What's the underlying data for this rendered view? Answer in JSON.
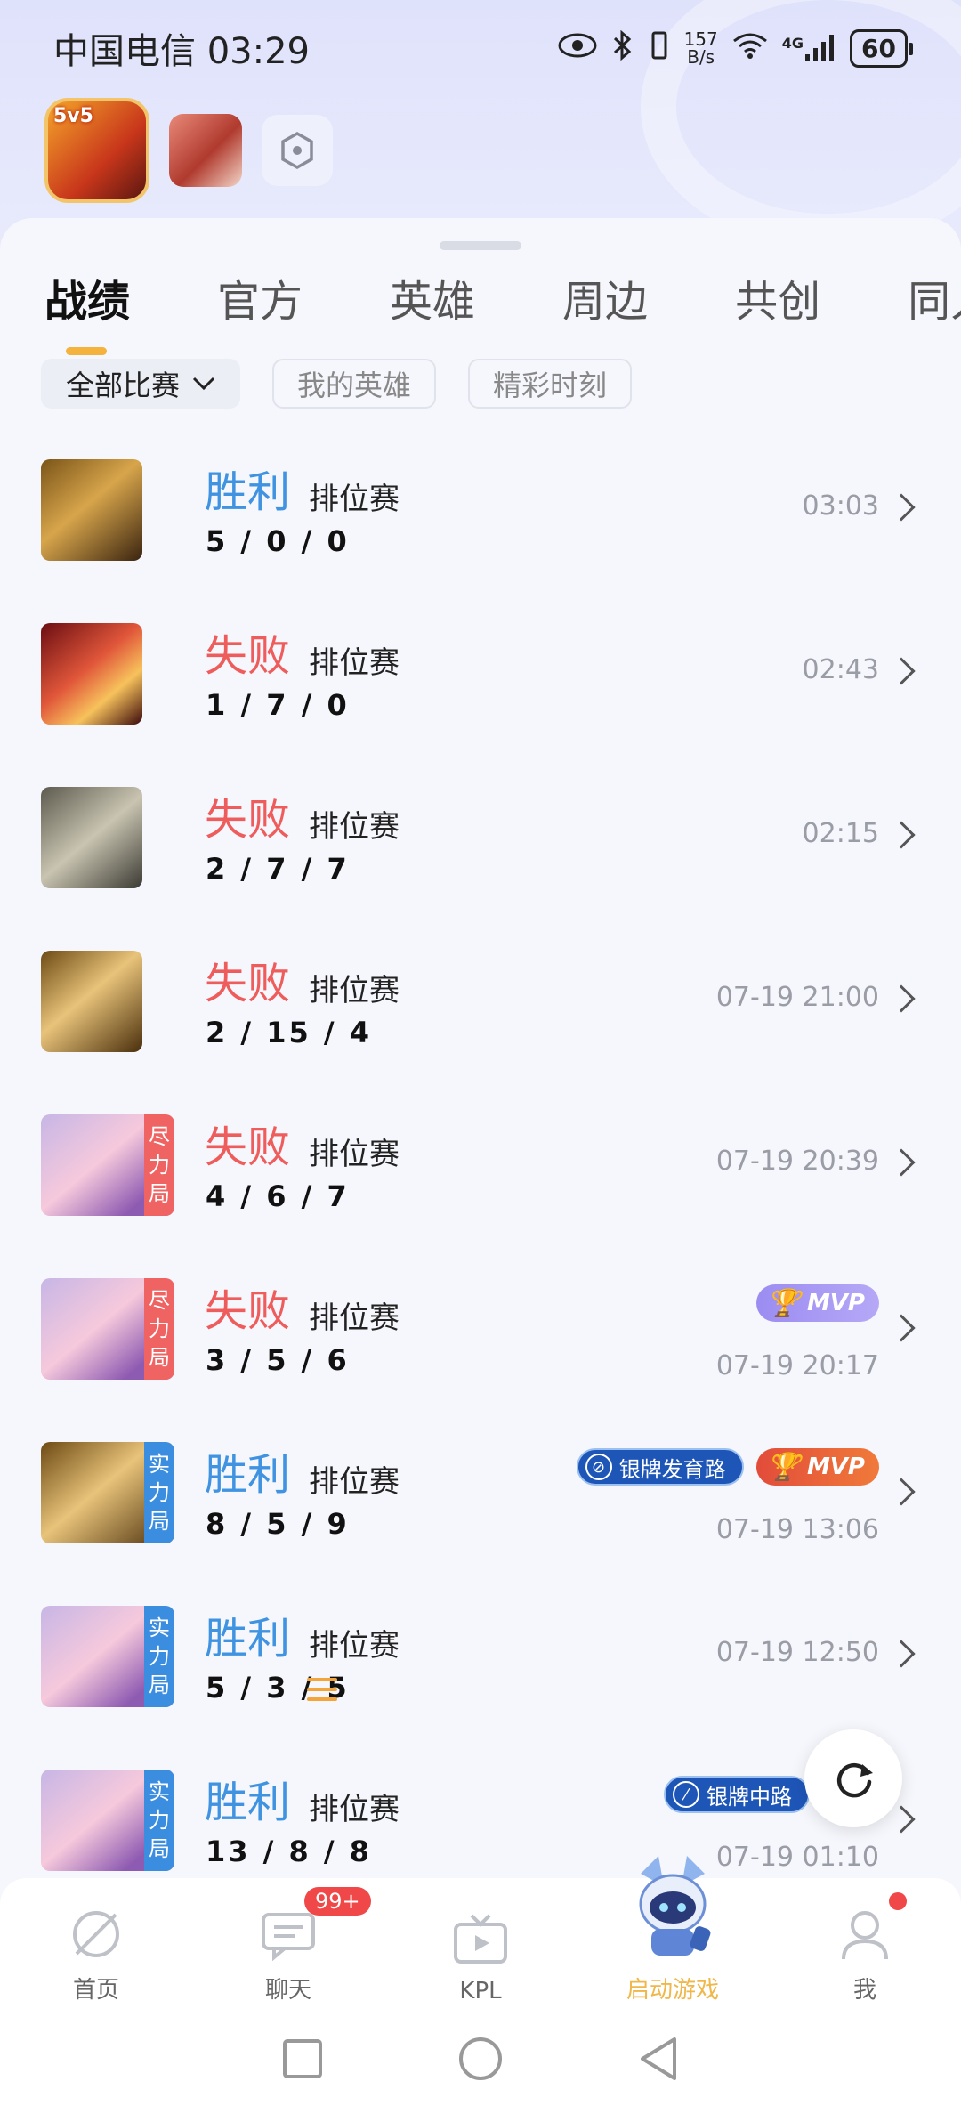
{
  "status_bar": {
    "carrier_time": "中国电信 03:29",
    "speed_top": "157",
    "speed_unit": "B/s",
    "network": "4G",
    "battery": "60"
  },
  "tabs": [
    "战绩",
    "官方",
    "英雄",
    "周边",
    "共创",
    "同人"
  ],
  "filters": {
    "all_matches": "全部比赛",
    "my_heroes": "我的英雄",
    "highlights": "精彩时刻"
  },
  "matches": [
    {
      "result": "胜利",
      "mode": "排位赛",
      "kda": "5 / 0 / 0",
      "time": "03:03"
    },
    {
      "result": "失败",
      "mode": "排位赛",
      "kda": "1 / 7 / 0",
      "time": "02:43"
    },
    {
      "result": "失败",
      "mode": "排位赛",
      "kda": "2 / 7 / 7",
      "time": "02:15"
    },
    {
      "result": "失败",
      "mode": "排位赛",
      "kda": "2 / 15 / 4",
      "time": "07-19 21:00"
    },
    {
      "result": "失败",
      "mode": "排位赛",
      "kda": "4 / 6 / 7",
      "time": "07-19 20:39",
      "tag": [
        "尽",
        "力",
        "局"
      ]
    },
    {
      "result": "失败",
      "mode": "排位赛",
      "kda": "3 / 5 / 6",
      "time": "07-19 20:17",
      "tag": [
        "尽",
        "力",
        "局"
      ],
      "badge": "MVP"
    },
    {
      "result": "胜利",
      "mode": "排位赛",
      "kda": "8 / 5 / 9",
      "time": "07-19 13:06",
      "tag": [
        "实",
        "力",
        "局"
      ],
      "pos_badge": "银牌发育路",
      "badge": "MVP"
    },
    {
      "result": "胜利",
      "mode": "排位赛",
      "kda": "5 / 3 / 5",
      "time": "07-19 12:50",
      "tag": [
        "实",
        "力",
        "局"
      ]
    },
    {
      "result": "胜利",
      "mode": "排位赛",
      "kda": "13 / 8 / 8",
      "time": "07-19 01:10",
      "tag": [
        "实",
        "力",
        "局"
      ],
      "pos_badge": "银牌中路"
    }
  ],
  "bottom_nav": {
    "home": "首页",
    "chat": "聊天",
    "chat_badge": "99+",
    "kpl": "KPL",
    "launch": "启动游戏",
    "me": "我"
  },
  "game_icon_label": "5v5",
  "colors": {
    "win": "#3f93e0",
    "lose": "#ee5c5c",
    "accent": "#f3b33d"
  }
}
